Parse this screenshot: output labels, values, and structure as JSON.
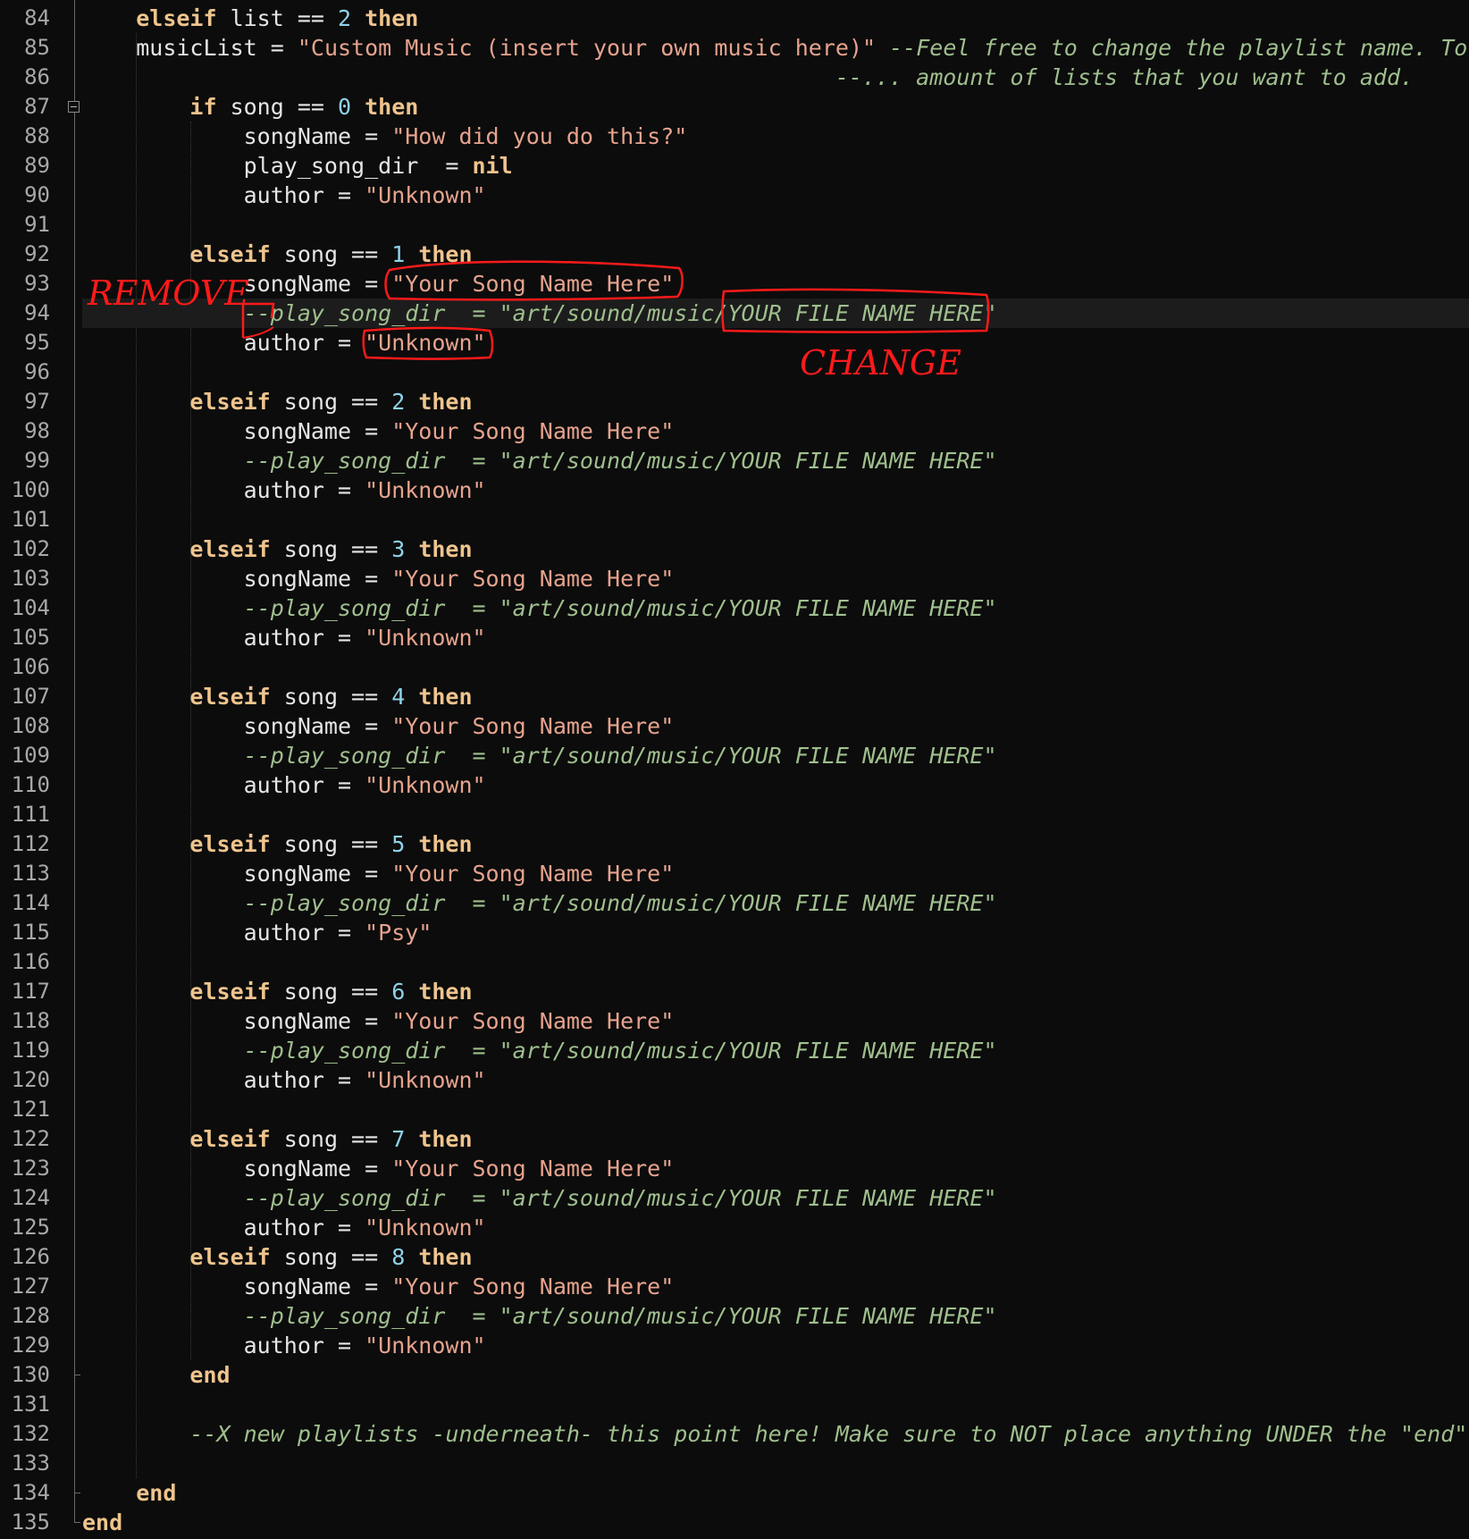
{
  "editor": {
    "current_line": 94,
    "lines": [
      {
        "n": "84",
        "indent": "    ",
        "tokens": [
          {
            "t": "kw",
            "v": "elseif"
          },
          {
            "t": "id",
            "v": " list == "
          },
          {
            "t": "num",
            "v": "2"
          },
          {
            "t": "id",
            "v": " "
          },
          {
            "t": "kw",
            "v": "then"
          }
        ]
      },
      {
        "n": "85",
        "indent": "    ",
        "tokens": [
          {
            "t": "id",
            "v": "musicList = "
          },
          {
            "t": "str",
            "v": "\"Custom Music (insert your own music here)\""
          },
          {
            "t": "id",
            "v": " "
          },
          {
            "t": "cmt",
            "v": "--Feel free to change the playlist name. To"
          }
        ]
      },
      {
        "n": "86",
        "indent": "                                                        ",
        "tokens": [
          {
            "t": "cmt",
            "v": "--... amount of lists that you want to add."
          }
        ]
      },
      {
        "n": "87",
        "indent": "        ",
        "tokens": [
          {
            "t": "kw",
            "v": "if"
          },
          {
            "t": "id",
            "v": " song == "
          },
          {
            "t": "num",
            "v": "0"
          },
          {
            "t": "id",
            "v": " "
          },
          {
            "t": "kw",
            "v": "then"
          }
        ]
      },
      {
        "n": "88",
        "indent": "            ",
        "tokens": [
          {
            "t": "id",
            "v": "songName = "
          },
          {
            "t": "str",
            "v": "\"How did you do this?\""
          }
        ]
      },
      {
        "n": "89",
        "indent": "            ",
        "tokens": [
          {
            "t": "id",
            "v": "play_song_dir  = "
          },
          {
            "t": "kw",
            "v": "nil"
          }
        ]
      },
      {
        "n": "90",
        "indent": "            ",
        "tokens": [
          {
            "t": "id",
            "v": "author = "
          },
          {
            "t": "str",
            "v": "\"Unknown\""
          }
        ]
      },
      {
        "n": "91",
        "indent": "",
        "tokens": []
      },
      {
        "n": "92",
        "indent": "        ",
        "tokens": [
          {
            "t": "kw",
            "v": "elseif"
          },
          {
            "t": "id",
            "v": " song == "
          },
          {
            "t": "num",
            "v": "1"
          },
          {
            "t": "id",
            "v": " "
          },
          {
            "t": "kw",
            "v": "then"
          }
        ]
      },
      {
        "n": "93",
        "indent": "            ",
        "tokens": [
          {
            "t": "id",
            "v": "songName = "
          },
          {
            "t": "str",
            "v": "\"Your Song Name Here\""
          }
        ]
      },
      {
        "n": "94",
        "indent": "            ",
        "tokens": [
          {
            "t": "cmt",
            "v": "--play_song_dir  = \"art/sound/music/YOUR FILE NAME HERE\""
          }
        ]
      },
      {
        "n": "95",
        "indent": "            ",
        "tokens": [
          {
            "t": "id",
            "v": "author = "
          },
          {
            "t": "str",
            "v": "\"Unknown\""
          }
        ]
      },
      {
        "n": "96",
        "indent": "",
        "tokens": []
      },
      {
        "n": "97",
        "indent": "        ",
        "tokens": [
          {
            "t": "kw",
            "v": "elseif"
          },
          {
            "t": "id",
            "v": " song == "
          },
          {
            "t": "num",
            "v": "2"
          },
          {
            "t": "id",
            "v": " "
          },
          {
            "t": "kw",
            "v": "then"
          }
        ]
      },
      {
        "n": "98",
        "indent": "            ",
        "tokens": [
          {
            "t": "id",
            "v": "songName = "
          },
          {
            "t": "str",
            "v": "\"Your Song Name Here\""
          }
        ]
      },
      {
        "n": "99",
        "indent": "            ",
        "tokens": [
          {
            "t": "cmt",
            "v": "--play_song_dir  = \"art/sound/music/YOUR FILE NAME HERE\""
          }
        ]
      },
      {
        "n": "100",
        "indent": "            ",
        "tokens": [
          {
            "t": "id",
            "v": "author = "
          },
          {
            "t": "str",
            "v": "\"Unknown\""
          }
        ]
      },
      {
        "n": "101",
        "indent": "",
        "tokens": []
      },
      {
        "n": "102",
        "indent": "        ",
        "tokens": [
          {
            "t": "kw",
            "v": "elseif"
          },
          {
            "t": "id",
            "v": " song == "
          },
          {
            "t": "num",
            "v": "3"
          },
          {
            "t": "id",
            "v": " "
          },
          {
            "t": "kw",
            "v": "then"
          }
        ]
      },
      {
        "n": "103",
        "indent": "            ",
        "tokens": [
          {
            "t": "id",
            "v": "songName = "
          },
          {
            "t": "str",
            "v": "\"Your Song Name Here\""
          }
        ]
      },
      {
        "n": "104",
        "indent": "            ",
        "tokens": [
          {
            "t": "cmt",
            "v": "--play_song_dir  = \"art/sound/music/YOUR FILE NAME HERE\""
          }
        ]
      },
      {
        "n": "105",
        "indent": "            ",
        "tokens": [
          {
            "t": "id",
            "v": "author = "
          },
          {
            "t": "str",
            "v": "\"Unknown\""
          }
        ]
      },
      {
        "n": "106",
        "indent": "",
        "tokens": []
      },
      {
        "n": "107",
        "indent": "        ",
        "tokens": [
          {
            "t": "kw",
            "v": "elseif"
          },
          {
            "t": "id",
            "v": " song == "
          },
          {
            "t": "num",
            "v": "4"
          },
          {
            "t": "id",
            "v": " "
          },
          {
            "t": "kw",
            "v": "then"
          }
        ]
      },
      {
        "n": "108",
        "indent": "            ",
        "tokens": [
          {
            "t": "id",
            "v": "songName = "
          },
          {
            "t": "str",
            "v": "\"Your Song Name Here\""
          }
        ]
      },
      {
        "n": "109",
        "indent": "            ",
        "tokens": [
          {
            "t": "cmt",
            "v": "--play_song_dir  = \"art/sound/music/YOUR FILE NAME HERE\""
          }
        ]
      },
      {
        "n": "110",
        "indent": "            ",
        "tokens": [
          {
            "t": "id",
            "v": "author = "
          },
          {
            "t": "str",
            "v": "\"Unknown\""
          }
        ]
      },
      {
        "n": "111",
        "indent": "",
        "tokens": []
      },
      {
        "n": "112",
        "indent": "        ",
        "tokens": [
          {
            "t": "kw",
            "v": "elseif"
          },
          {
            "t": "id",
            "v": " song == "
          },
          {
            "t": "num",
            "v": "5"
          },
          {
            "t": "id",
            "v": " "
          },
          {
            "t": "kw",
            "v": "then"
          }
        ]
      },
      {
        "n": "113",
        "indent": "            ",
        "tokens": [
          {
            "t": "id",
            "v": "songName = "
          },
          {
            "t": "str",
            "v": "\"Your Song Name Here\""
          }
        ]
      },
      {
        "n": "114",
        "indent": "            ",
        "tokens": [
          {
            "t": "cmt",
            "v": "--play_song_dir  = \"art/sound/music/YOUR FILE NAME HERE\""
          }
        ]
      },
      {
        "n": "115",
        "indent": "            ",
        "tokens": [
          {
            "t": "id",
            "v": "author = "
          },
          {
            "t": "str",
            "v": "\"Psy\""
          }
        ]
      },
      {
        "n": "116",
        "indent": "",
        "tokens": []
      },
      {
        "n": "117",
        "indent": "        ",
        "tokens": [
          {
            "t": "kw",
            "v": "elseif"
          },
          {
            "t": "id",
            "v": " song == "
          },
          {
            "t": "num",
            "v": "6"
          },
          {
            "t": "id",
            "v": " "
          },
          {
            "t": "kw",
            "v": "then"
          }
        ]
      },
      {
        "n": "118",
        "indent": "            ",
        "tokens": [
          {
            "t": "id",
            "v": "songName = "
          },
          {
            "t": "str",
            "v": "\"Your Song Name Here\""
          }
        ]
      },
      {
        "n": "119",
        "indent": "            ",
        "tokens": [
          {
            "t": "cmt",
            "v": "--play_song_dir  = \"art/sound/music/YOUR FILE NAME HERE\""
          }
        ]
      },
      {
        "n": "120",
        "indent": "            ",
        "tokens": [
          {
            "t": "id",
            "v": "author = "
          },
          {
            "t": "str",
            "v": "\"Unknown\""
          }
        ]
      },
      {
        "n": "121",
        "indent": "",
        "tokens": []
      },
      {
        "n": "122",
        "indent": "        ",
        "tokens": [
          {
            "t": "kw",
            "v": "elseif"
          },
          {
            "t": "id",
            "v": " song == "
          },
          {
            "t": "num",
            "v": "7"
          },
          {
            "t": "id",
            "v": " "
          },
          {
            "t": "kw",
            "v": "then"
          }
        ]
      },
      {
        "n": "123",
        "indent": "            ",
        "tokens": [
          {
            "t": "id",
            "v": "songName = "
          },
          {
            "t": "str",
            "v": "\"Your Song Name Here\""
          }
        ]
      },
      {
        "n": "124",
        "indent": "            ",
        "tokens": [
          {
            "t": "cmt",
            "v": "--play_song_dir  = \"art/sound/music/YOUR FILE NAME HERE\""
          }
        ]
      },
      {
        "n": "125",
        "indent": "            ",
        "tokens": [
          {
            "t": "id",
            "v": "author = "
          },
          {
            "t": "str",
            "v": "\"Unknown\""
          }
        ]
      },
      {
        "n": "126",
        "indent": "        ",
        "tokens": [
          {
            "t": "kw",
            "v": "elseif"
          },
          {
            "t": "id",
            "v": " song == "
          },
          {
            "t": "num",
            "v": "8"
          },
          {
            "t": "id",
            "v": " "
          },
          {
            "t": "kw",
            "v": "then"
          }
        ]
      },
      {
        "n": "127",
        "indent": "            ",
        "tokens": [
          {
            "t": "id",
            "v": "songName = "
          },
          {
            "t": "str",
            "v": "\"Your Song Name Here\""
          }
        ]
      },
      {
        "n": "128",
        "indent": "            ",
        "tokens": [
          {
            "t": "cmt",
            "v": "--play_song_dir  = \"art/sound/music/YOUR FILE NAME HERE\""
          }
        ]
      },
      {
        "n": "129",
        "indent": "            ",
        "tokens": [
          {
            "t": "id",
            "v": "author = "
          },
          {
            "t": "str",
            "v": "\"Unknown\""
          }
        ]
      },
      {
        "n": "130",
        "indent": "        ",
        "tokens": [
          {
            "t": "kw",
            "v": "end"
          }
        ]
      },
      {
        "n": "131",
        "indent": "",
        "tokens": []
      },
      {
        "n": "132",
        "indent": "        ",
        "tokens": [
          {
            "t": "cmt",
            "v": "--X new playlists -underneath- this point here! Make sure to NOT place anything UNDER the \"end\""
          }
        ]
      },
      {
        "n": "133",
        "indent": "",
        "tokens": []
      },
      {
        "n": "134",
        "indent": "    ",
        "tokens": [
          {
            "t": "kw",
            "v": "end"
          }
        ]
      },
      {
        "n": "135",
        "indent": "",
        "tokens": [
          {
            "t": "kw",
            "v": "end"
          }
        ]
      }
    ]
  },
  "annotations": {
    "remove_label": "REMOVE",
    "change_label": "CHANGE",
    "color": "#ff1a1a"
  },
  "colors": {
    "background": "#0c0c0c",
    "keyword": "#efc48d",
    "number": "#8fd2e8",
    "string": "#e6a38e",
    "comment": "#9fbf8e",
    "text": "#e6e6e6",
    "line_number": "#a8a8a8"
  }
}
